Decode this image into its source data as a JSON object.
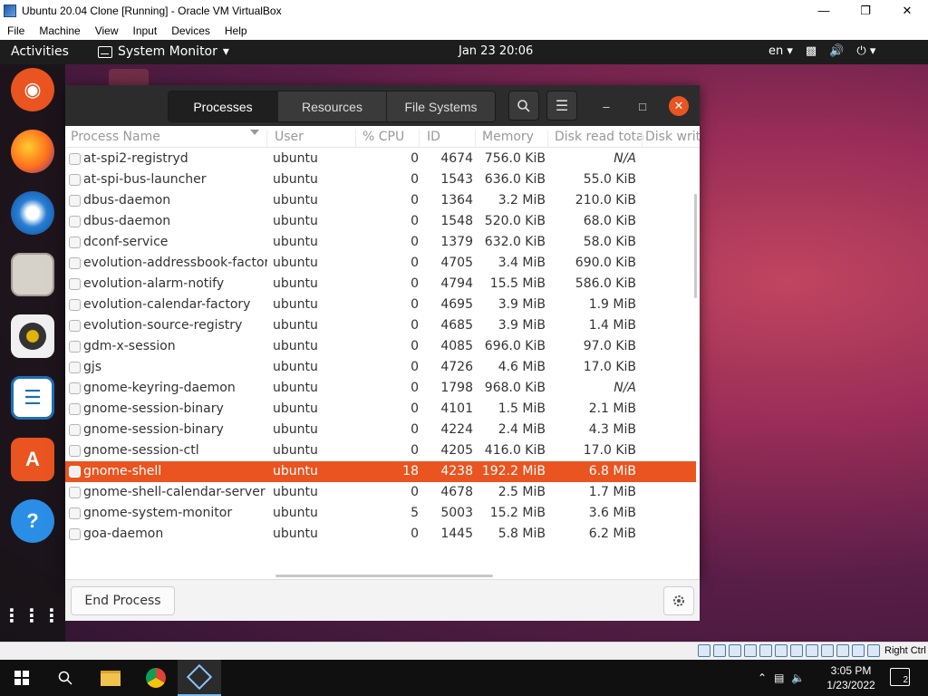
{
  "vbox": {
    "title": "Ubuntu 20.04 Clone [Running] - Oracle VM VirtualBox",
    "menu": [
      "File",
      "Machine",
      "View",
      "Input",
      "Devices",
      "Help"
    ],
    "host_key": "Right Ctrl"
  },
  "gnome_topbar": {
    "activities": "Activities",
    "app_name": "System Monitor",
    "clock": "Jan 23  20:06",
    "keyboard_layout": "en"
  },
  "dock": [
    "ubuntu-logo-icon",
    "firefox-icon",
    "thunderbird-icon",
    "files-icon",
    "rhythmbox-icon",
    "libreoffice-writer-icon",
    "ubuntu-software-icon",
    "help-icon",
    "show-applications-icon"
  ],
  "sysmon": {
    "tabs": [
      {
        "label": "Processes",
        "active": true
      },
      {
        "label": "Resources",
        "active": false
      },
      {
        "label": "File Systems",
        "active": false
      }
    ],
    "columns": [
      "Process Name",
      "User",
      "% CPU",
      "ID",
      "Memory",
      "Disk read tota",
      "Disk writ"
    ],
    "processes": [
      {
        "name": "at-spi2-registryd",
        "user": "ubuntu",
        "cpu": "0",
        "id": "4674",
        "memory": "756.0 KiB",
        "disk_read": "N/A"
      },
      {
        "name": "at-spi-bus-launcher",
        "user": "ubuntu",
        "cpu": "0",
        "id": "1543",
        "memory": "636.0 KiB",
        "disk_read": "55.0 KiB"
      },
      {
        "name": "dbus-daemon",
        "user": "ubuntu",
        "cpu": "0",
        "id": "1364",
        "memory": "3.2 MiB",
        "disk_read": "210.0 KiB"
      },
      {
        "name": "dbus-daemon",
        "user": "ubuntu",
        "cpu": "0",
        "id": "1548",
        "memory": "520.0 KiB",
        "disk_read": "68.0 KiB"
      },
      {
        "name": "dconf-service",
        "user": "ubuntu",
        "cpu": "0",
        "id": "1379",
        "memory": "632.0 KiB",
        "disk_read": "58.0 KiB"
      },
      {
        "name": "evolution-addressbook-factory",
        "user": "ubuntu",
        "cpu": "0",
        "id": "4705",
        "memory": "3.4 MiB",
        "disk_read": "690.0 KiB"
      },
      {
        "name": "evolution-alarm-notify",
        "user": "ubuntu",
        "cpu": "0",
        "id": "4794",
        "memory": "15.5 MiB",
        "disk_read": "586.0 KiB"
      },
      {
        "name": "evolution-calendar-factory",
        "user": "ubuntu",
        "cpu": "0",
        "id": "4695",
        "memory": "3.9 MiB",
        "disk_read": "1.9 MiB"
      },
      {
        "name": "evolution-source-registry",
        "user": "ubuntu",
        "cpu": "0",
        "id": "4685",
        "memory": "3.9 MiB",
        "disk_read": "1.4 MiB"
      },
      {
        "name": "gdm-x-session",
        "user": "ubuntu",
        "cpu": "0",
        "id": "4085",
        "memory": "696.0 KiB",
        "disk_read": "97.0 KiB"
      },
      {
        "name": "gjs",
        "user": "ubuntu",
        "cpu": "0",
        "id": "4726",
        "memory": "4.6 MiB",
        "disk_read": "17.0 KiB"
      },
      {
        "name": "gnome-keyring-daemon",
        "user": "ubuntu",
        "cpu": "0",
        "id": "1798",
        "memory": "968.0 KiB",
        "disk_read": "N/A"
      },
      {
        "name": "gnome-session-binary",
        "user": "ubuntu",
        "cpu": "0",
        "id": "4101",
        "memory": "1.5 MiB",
        "disk_read": "2.1 MiB"
      },
      {
        "name": "gnome-session-binary",
        "user": "ubuntu",
        "cpu": "0",
        "id": "4224",
        "memory": "2.4 MiB",
        "disk_read": "4.3 MiB"
      },
      {
        "name": "gnome-session-ctl",
        "user": "ubuntu",
        "cpu": "0",
        "id": "4205",
        "memory": "416.0 KiB",
        "disk_read": "17.0 KiB"
      },
      {
        "name": "gnome-shell",
        "user": "ubuntu",
        "cpu": "18",
        "id": "4238",
        "memory": "192.2 MiB",
        "disk_read": "6.8 MiB",
        "selected": true
      },
      {
        "name": "gnome-shell-calendar-server",
        "user": "ubuntu",
        "cpu": "0",
        "id": "4678",
        "memory": "2.5 MiB",
        "disk_read": "1.7 MiB"
      },
      {
        "name": "gnome-system-monitor",
        "user": "ubuntu",
        "cpu": "5",
        "id": "5003",
        "memory": "15.2 MiB",
        "disk_read": "3.6 MiB"
      },
      {
        "name": "goa-daemon",
        "user": "ubuntu",
        "cpu": "0",
        "id": "1445",
        "memory": "5.8 MiB",
        "disk_read": "6.2 MiB"
      }
    ],
    "end_process_label": "End Process"
  },
  "taskbar": {
    "items": [
      "windows-start-icon",
      "search-icon",
      "file-explorer-icon",
      "chrome-icon",
      "virtualbox-icon"
    ],
    "time": "3:05 PM",
    "date": "1/23/2022",
    "notification_count": "2"
  },
  "colors": {
    "ubuntu_orange": "#e95420",
    "headerbar": "#2c2c2c",
    "gnome_topbar": "#1d1d1d"
  }
}
